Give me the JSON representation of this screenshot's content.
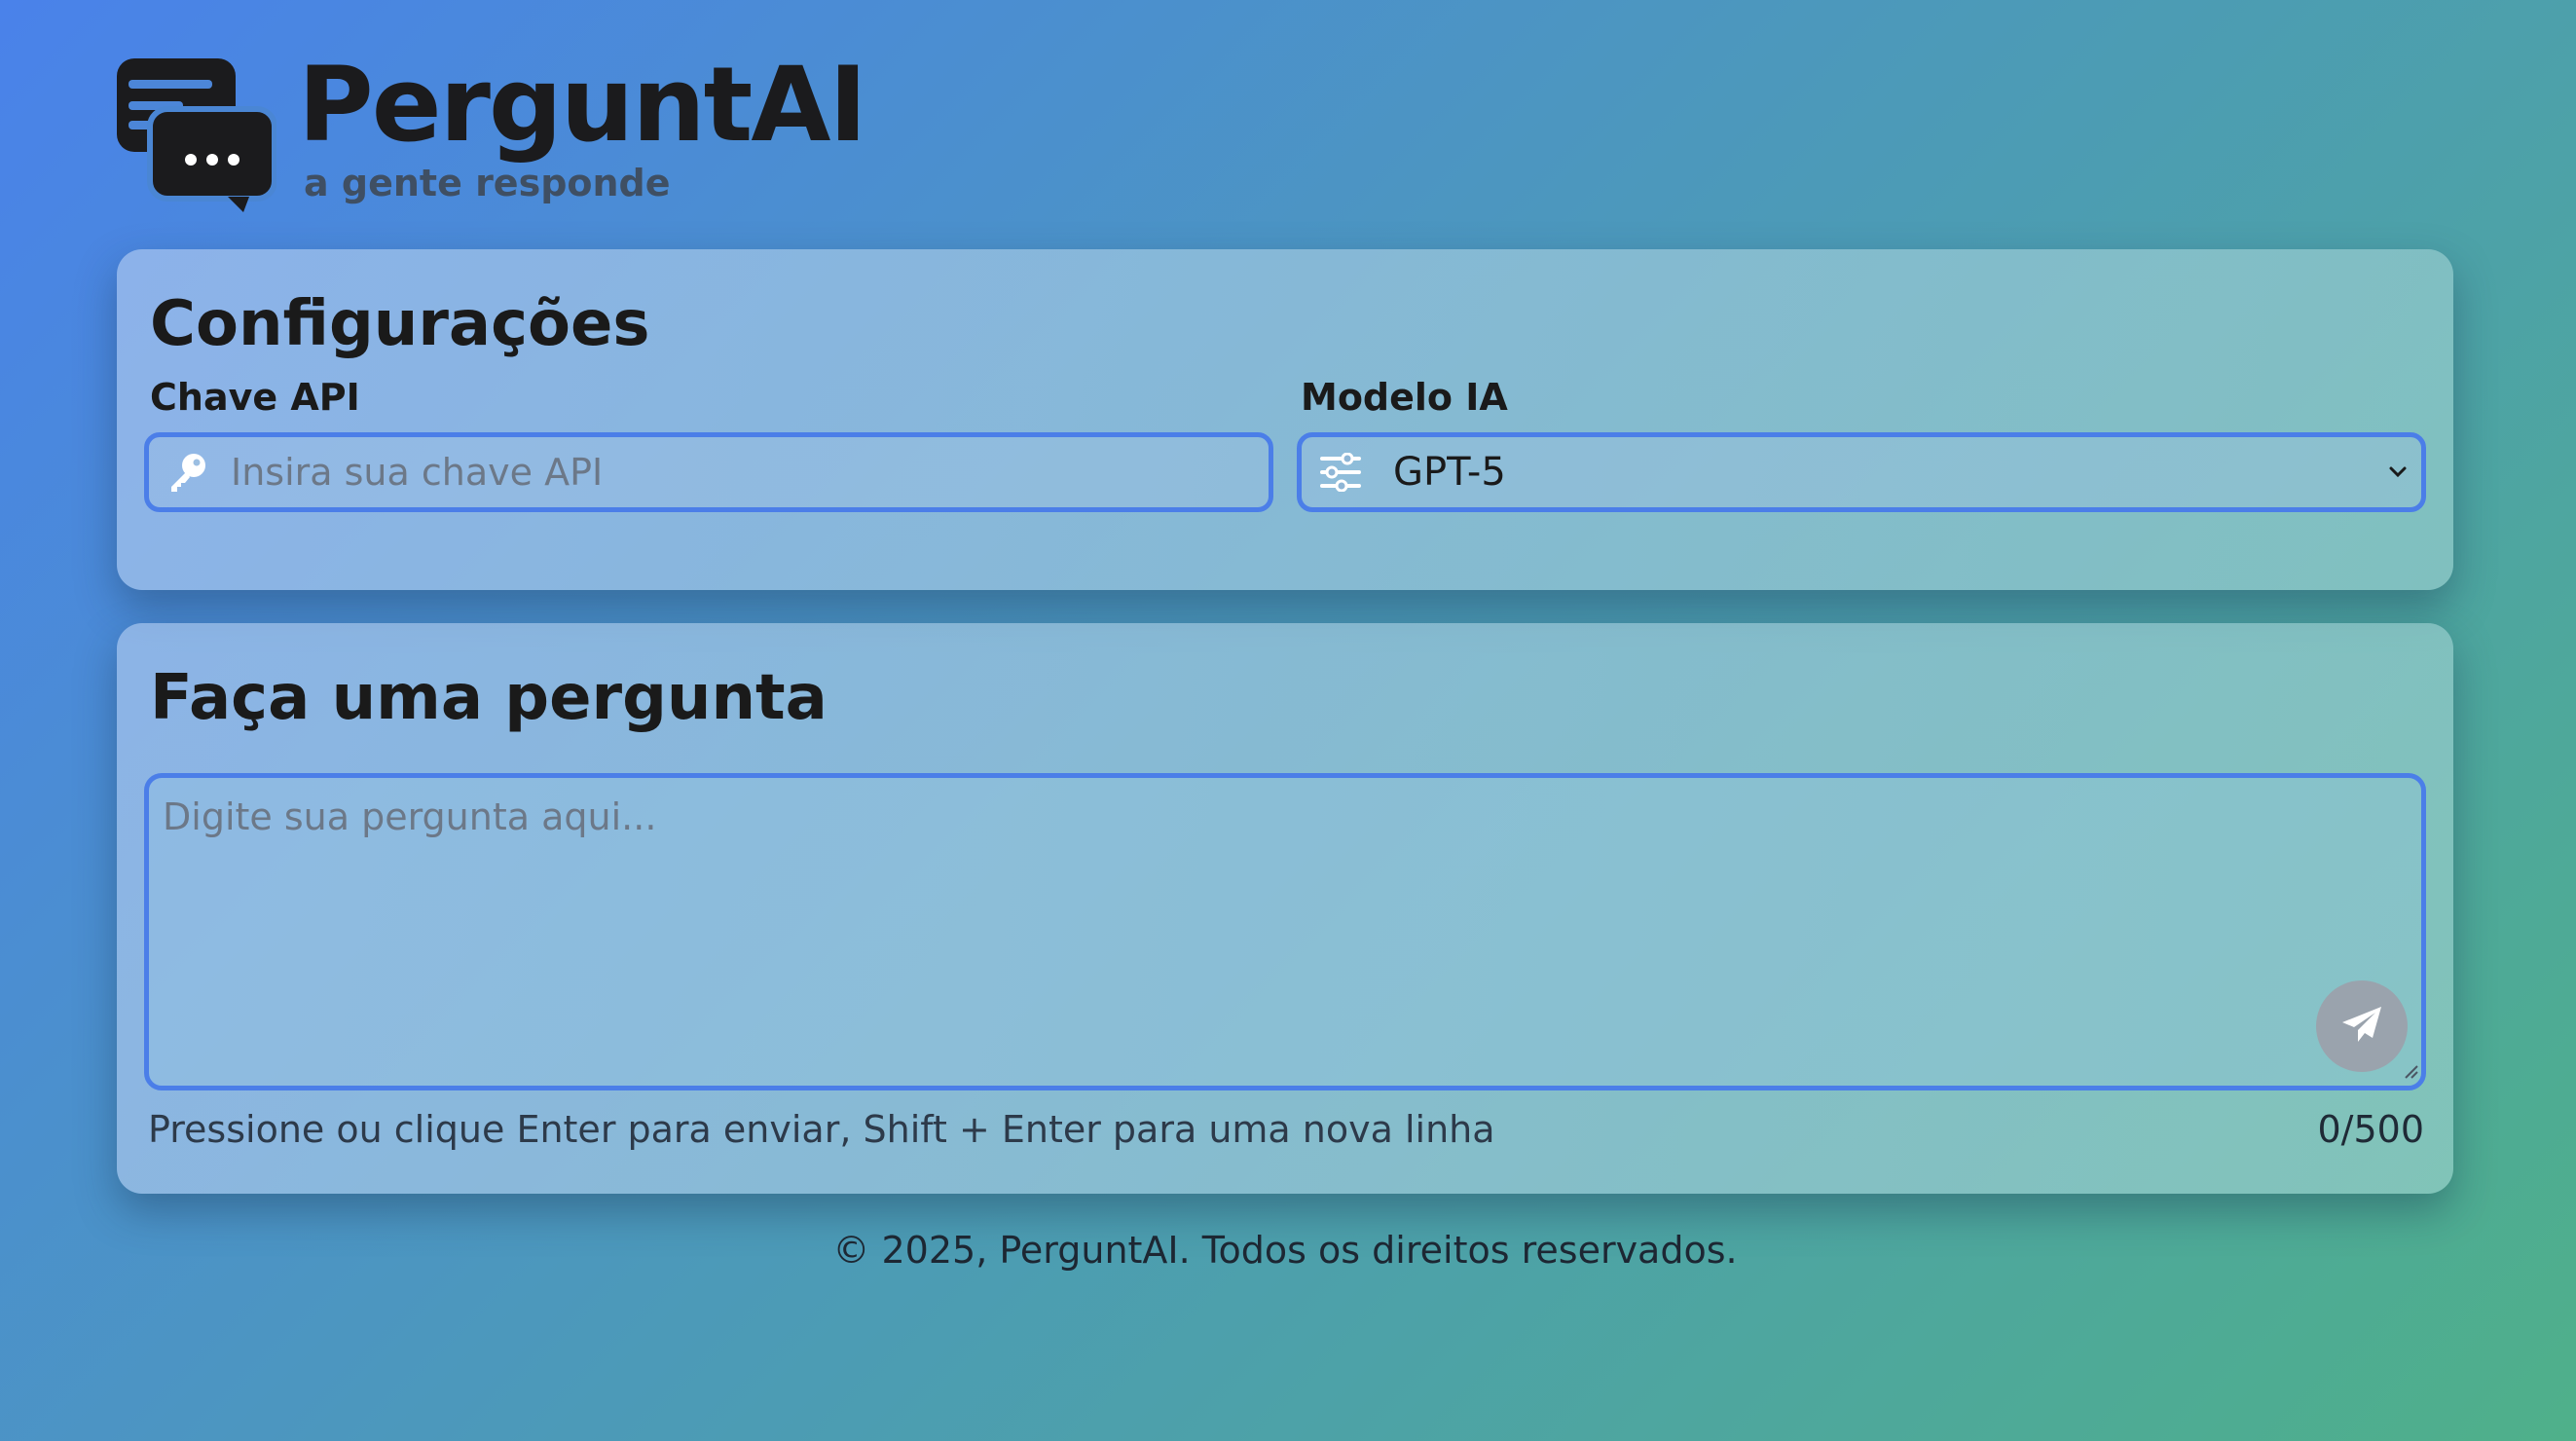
{
  "brand": {
    "title": "PerguntAI",
    "subtitle": "a gente responde",
    "logo_icon": "chat-bubbles-icon"
  },
  "config": {
    "title": "Configurações",
    "api_key": {
      "label": "Chave API",
      "placeholder": "Insira sua chave API",
      "value": "",
      "icon": "key-icon"
    },
    "model": {
      "label": "Modelo IA",
      "selected": "GPT-5",
      "icon": "sliders-icon"
    }
  },
  "ask": {
    "title": "Faça uma pergunta",
    "placeholder": "Digite sua pergunta aqui...",
    "value": "",
    "hint": "Pressione ou clique Enter para enviar, Shift + Enter para uma nova linha",
    "counter": "0/500",
    "send_icon": "paper-plane-icon"
  },
  "footer": {
    "text": "© 2025, PerguntAI. Todos os direitos reservados."
  },
  "colors": {
    "accent_border": "#4b7ee8",
    "send_button": "#9aa3ad",
    "background_start": "#4a82ea",
    "background_end": "#4fb08a"
  }
}
